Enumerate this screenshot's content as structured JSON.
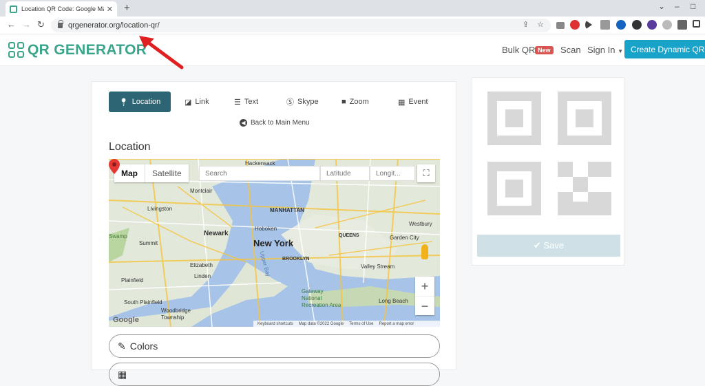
{
  "browser": {
    "tab_title": "Location QR Code: Google Maps",
    "url": "qrgenerator.org/location-qr/"
  },
  "site": {
    "logo": "QR GENERATOR",
    "nav": {
      "bulk": "Bulk QR",
      "new_badge": "New",
      "scan": "Scan",
      "signin": "Sign In",
      "cta": "Create Dynamic QR Code"
    }
  },
  "qr_types": [
    {
      "label": "Location",
      "icon": "pin-icon"
    },
    {
      "label": "Link",
      "icon": "link-icon"
    },
    {
      "label": "Text",
      "icon": "text-icon"
    },
    {
      "label": "Skype",
      "icon": "skype-icon"
    },
    {
      "label": "Zoom",
      "icon": "video-icon"
    },
    {
      "label": "Event",
      "icon": "calendar-icon"
    }
  ],
  "back_link": "Back to Main Menu",
  "section_title": "Location",
  "map": {
    "type_map": "Map",
    "type_satellite": "Satellite",
    "search_placeholder": "Search",
    "latitude_placeholder": "Latitude",
    "longitude_placeholder": "Longit...",
    "labels": {
      "hackensack": "Hackensack",
      "montclair": "Montclair",
      "livingston": "Livingston",
      "manhattan": "MANHATTAN",
      "newark": "Newark",
      "hoboken": "Hoboken",
      "newyork": "New York",
      "queens": "QUEENS",
      "westbury": "Westbury",
      "gardencity": "Garden City",
      "swamp": "Swamp",
      "summit": "Summit",
      "brooklyn": "BROOKLYN",
      "elizabeth": "Elizabeth",
      "linden": "Linden",
      "valleystream": "Valley Stream",
      "plainfield": "Plainfield",
      "upperbay": "Upper Bay",
      "gateway": "Gateway National Recreation Area",
      "southplainfield": "South Plainfield",
      "woodbridge": "Woodbridge Township",
      "longbeach": "Long Beach"
    },
    "brand": "Google",
    "footer": [
      "Keyboard shortcuts",
      "Map data ©2022 Google",
      "Terms of Use",
      "Report a map error"
    ]
  },
  "accordion": {
    "colors": "Colors"
  },
  "save_label": "Save",
  "colors": {
    "accent": "#3aa58a",
    "active_tab": "#2e6574",
    "cta": "#1aa3c8",
    "badge": "#d9534f",
    "arrow": "#e02020"
  }
}
